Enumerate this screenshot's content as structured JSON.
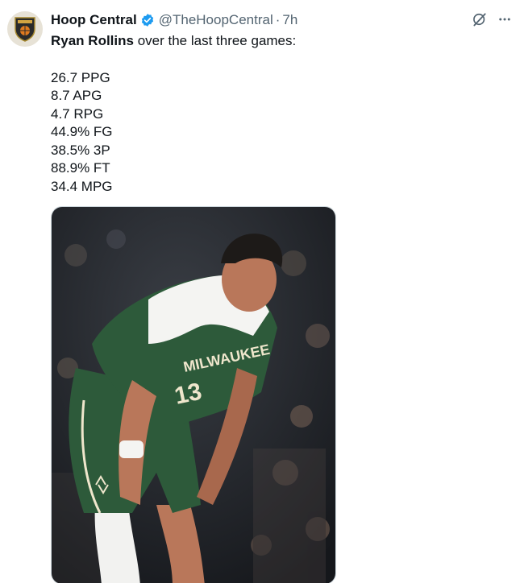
{
  "account": {
    "display_name": "Hoop Central",
    "handle": "@TheHoopCentral",
    "separator": "·",
    "time": "7h",
    "verified": true,
    "avatar_icon": "hoop-central-shield-logo"
  },
  "tweet": {
    "subject": "Ryan Rollins",
    "intro_rest": " over the last three games:",
    "stats": [
      "26.7 PPG",
      "8.7 APG",
      "4.7 RPG",
      "44.9% FG",
      "38.5% 3P",
      "88.9% FT",
      "34.4 MPG"
    ]
  },
  "actions": {
    "grok_icon": "grok-icon",
    "more_icon": "more-icon"
  },
  "media": {
    "kind": "photo",
    "jersey_text": "MILWAUKEE",
    "jersey_number": "13"
  },
  "colors": {
    "verified_blue": "#1d9bf0",
    "secondary_text": "#536471",
    "jersey_green": "#2d5a3a",
    "jersey_cream": "#efe6cc"
  }
}
